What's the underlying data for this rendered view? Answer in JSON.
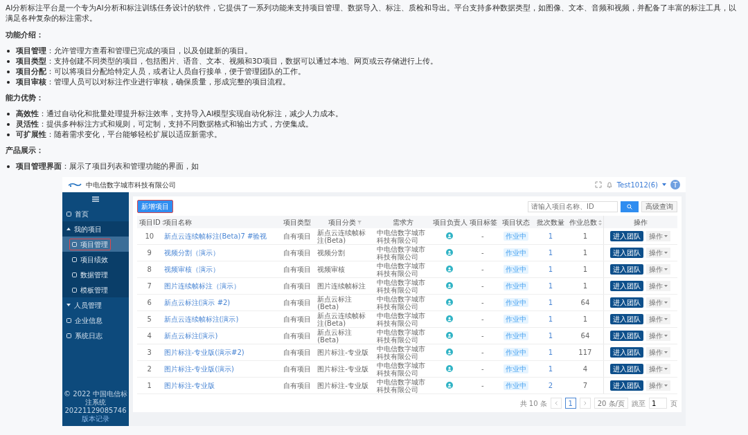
{
  "intro": "AI分析标注平台是一个专为AI分析和标注训练任务设计的软件，它提供了一系列功能来支持项目管理、数据导入、标注、质检和导出。平台支持多种数据类型，如图像、文本、音频和视频，并配备了丰富的标注工具，以满足各种复杂的标注需求。",
  "sections": [
    {
      "heading": "功能介绍：",
      "items": [
        "**项目管理**：允许管理方查看和管理已完成的项目，以及创建新的项目。",
        "**项目类型**：支持创建不同类型的项目，包括图片、语音、文本、视频和3D项目，数据可以通过本地、网页或云存储进行上传。",
        "**项目分配**：可以将项目分配给特定人员，或者让人员自行接单，便于管理团队的工作。",
        "**项目审核**：管理人员可以对标注作业进行审核，确保质量，形成完整的项目流程。"
      ]
    },
    {
      "heading": "能力优势：",
      "items": [
        "**高效性**：通过自动化和批量处理提升标注效率，支持导入AI模型实现自动化标注，减少人力成本。",
        "**灵活性**：提供多种标注方式和规则，可定制，支持不同数据格式和输出方式，方便集成。",
        "**可扩展性**：随着需求变化，平台能够轻松扩展以适应新需求。"
      ]
    },
    {
      "heading": "产品展示：",
      "items": [
        "**项目管理界面**：展示了项目列表和管理功能的界面，如"
      ]
    }
  ],
  "app": {
    "company": "中电信数字城市科技有限公司",
    "user": "Test1012(6)",
    "avatar": "T",
    "nav": [
      {
        "label": "首页",
        "selected": false
      },
      {
        "label": "我的项目",
        "selected": false,
        "expanded": true,
        "children": [
          {
            "label": "项目管理",
            "selected": true,
            "outlined": true
          },
          {
            "label": "项目绩效",
            "selected": false,
            "outlined": false
          },
          {
            "label": "数据管理",
            "selected": false,
            "outlined": false
          },
          {
            "label": "模板管理",
            "selected": false,
            "outlined": false
          }
        ]
      },
      {
        "label": "人员管理",
        "selected": false,
        "expanded": false
      },
      {
        "label": "企业信息",
        "selected": false
      },
      {
        "label": "系统日志",
        "selected": false
      }
    ],
    "footer": [
      "© 2022 中国电信标注系统",
      "20221129085746"
    ],
    "footer_link": "版本记录",
    "new_button": {
      "label": "新增项目",
      "outlined": true
    },
    "search": {
      "placeholder": "请输入项目名称、ID"
    },
    "advanced": "高级查询",
    "columns": [
      {
        "label": "项目ID",
        "kind": "sort"
      },
      {
        "label": "项目名称",
        "kind": "plain"
      },
      {
        "label": "项目类型",
        "kind": "plain"
      },
      {
        "label": "项目分类",
        "kind": "filter"
      },
      {
        "label": "需求方",
        "kind": "plain"
      },
      {
        "label": "项目负责人",
        "kind": "plain"
      },
      {
        "label": "项目标签",
        "kind": "plain"
      },
      {
        "label": "项目状态",
        "kind": "plain"
      },
      {
        "label": "批次数量",
        "kind": "plain"
      },
      {
        "label": "作业总数",
        "kind": "sort"
      },
      {
        "label": "操作",
        "kind": "plain"
      }
    ],
    "rows": [
      {
        "id": "10",
        "name": "新点云连续帧标注(Beta)7 #验视",
        "type": "自有项目",
        "category": "新点云连续帧标注(Beta)",
        "client": "中电信数字城市科技有限公司",
        "tag": "-",
        "status": "作业中",
        "batches": "1",
        "jobs": "1",
        "enter": "进入团队",
        "more": "操作"
      },
      {
        "id": "9",
        "name": "视频分割（演示）",
        "type": "自有项目",
        "category": "视频分割",
        "client": "中电信数字城市科技有限公司",
        "tag": "-",
        "status": "作业中",
        "batches": "1",
        "jobs": "1",
        "enter": "进入团队",
        "more": "操作"
      },
      {
        "id": "8",
        "name": "视频审核（演示）",
        "type": "自有项目",
        "category": "视频审核",
        "client": "中电信数字城市科技有限公司",
        "tag": "-",
        "status": "作业中",
        "batches": "1",
        "jobs": "1",
        "enter": "进入团队",
        "more": "操作"
      },
      {
        "id": "7",
        "name": "图片连续帧标注（演示）",
        "type": "自有项目",
        "category": "图片连续帧标注",
        "client": "中电信数字城市科技有限公司",
        "tag": "-",
        "status": "作业中",
        "batches": "1",
        "jobs": "1",
        "enter": "进入团队",
        "more": "操作"
      },
      {
        "id": "6",
        "name": "新点云标注(演示 #2)",
        "type": "自有项目",
        "category": "新点云标注(Beta)",
        "client": "中电信数字城市科技有限公司",
        "tag": "-",
        "status": "作业中",
        "batches": "1",
        "jobs": "64",
        "enter": "进入团队",
        "more": "操作"
      },
      {
        "id": "5",
        "name": "新点云连续帧标注(演示)",
        "type": "自有项目",
        "category": "新点云连续帧标注(Beta)",
        "client": "中电信数字城市科技有限公司",
        "tag": "-",
        "status": "作业中",
        "batches": "1",
        "jobs": "1",
        "enter": "进入团队",
        "more": "操作"
      },
      {
        "id": "4",
        "name": "新点云标注(演示)",
        "type": "自有项目",
        "category": "新点云标注(Beta)",
        "client": "中电信数字城市科技有限公司",
        "tag": "-",
        "status": "作业中",
        "batches": "1",
        "jobs": "64",
        "enter": "进入团队",
        "more": "操作"
      },
      {
        "id": "3",
        "name": "图片标注-专业版(演示#2)",
        "type": "自有项目",
        "category": "图片标注-专业版",
        "client": "中电信数字城市科技有限公司",
        "tag": "-",
        "status": "作业中",
        "batches": "1",
        "jobs": "117",
        "enter": "进入团队",
        "more": "操作"
      },
      {
        "id": "2",
        "name": "图片标注-专业版(演示)",
        "type": "自有项目",
        "category": "图片标注-专业版",
        "client": "中电信数字城市科技有限公司",
        "tag": "-",
        "status": "作业中",
        "batches": "1",
        "jobs": "4",
        "enter": "进入团队",
        "more": "操作"
      },
      {
        "id": "1",
        "name": "图片标注-专业版",
        "type": "自有项目",
        "category": "图片标注-专业版",
        "client": "中电信数字城市科技有限公司",
        "tag": "-",
        "status": "作业中",
        "batches": "2",
        "jobs": "7",
        "enter": "进入团队",
        "more": "操作"
      }
    ],
    "pagination": {
      "total": "共 10 条",
      "pages": [
        {
          "label": "1",
          "selected": true
        }
      ],
      "page_size": "20 条/页",
      "jump_label": "跳至",
      "jump_value": "1",
      "jump_unit": "页"
    }
  }
}
